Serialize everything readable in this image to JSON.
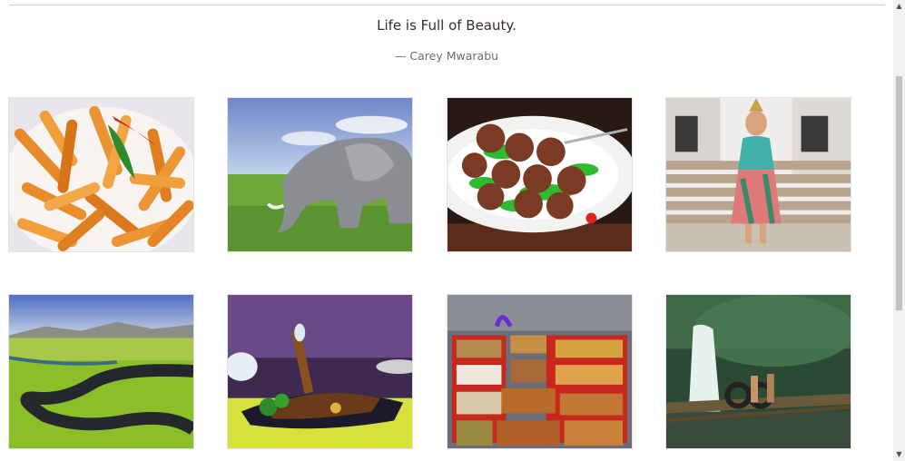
{
  "quote": {
    "text": "Life is Full of Beauty.",
    "author": "— Carey Mwarabu"
  },
  "gallery": {
    "images": [
      {
        "subject": "pasta"
      },
      {
        "subject": "elephant"
      },
      {
        "subject": "meatballs"
      },
      {
        "subject": "woman-on-steps"
      },
      {
        "subject": "river-landscape"
      },
      {
        "subject": "grilled-dish"
      },
      {
        "subject": "street-food-stall"
      },
      {
        "subject": "waterfall"
      }
    ]
  },
  "scrollbar": {
    "up_icon": "triangle-up-icon",
    "down_icon": "triangle-down-icon"
  }
}
